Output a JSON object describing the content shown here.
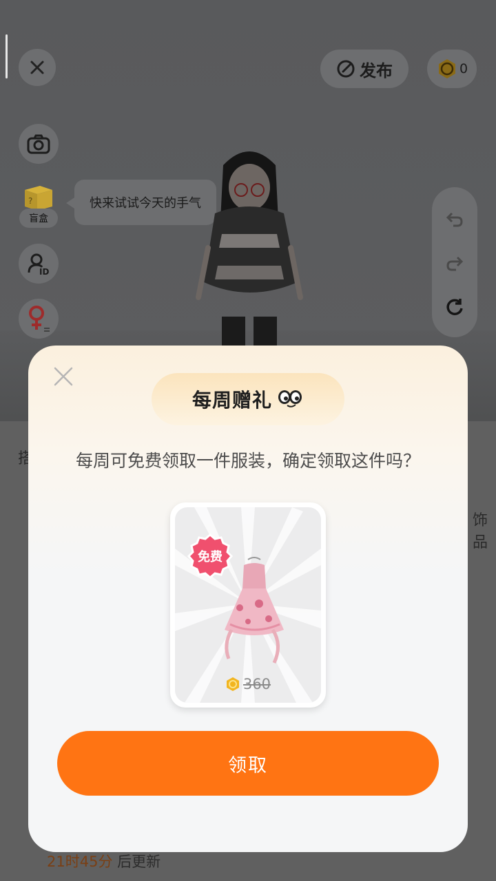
{
  "toolbar": {
    "publish_label": "发布",
    "coin_count": "0"
  },
  "left_tools": {
    "blindbox_label": "盲盒",
    "speech_text": "快来试试今天的手气"
  },
  "background": {
    "timer_time": "21时45分",
    "timer_suffix": " 后更新",
    "partial_tab_left": "搭",
    "partial_tab_right": "饰品"
  },
  "modal": {
    "title": "每周赠礼",
    "description": "每周可免费领取一件服装，确定领取这件吗？",
    "badge_label": "免费",
    "item_price": "360",
    "claim_label": "领取"
  },
  "colors": {
    "accent": "#ff7413",
    "badge": "#f0506e",
    "coin": "#f2b51f"
  }
}
